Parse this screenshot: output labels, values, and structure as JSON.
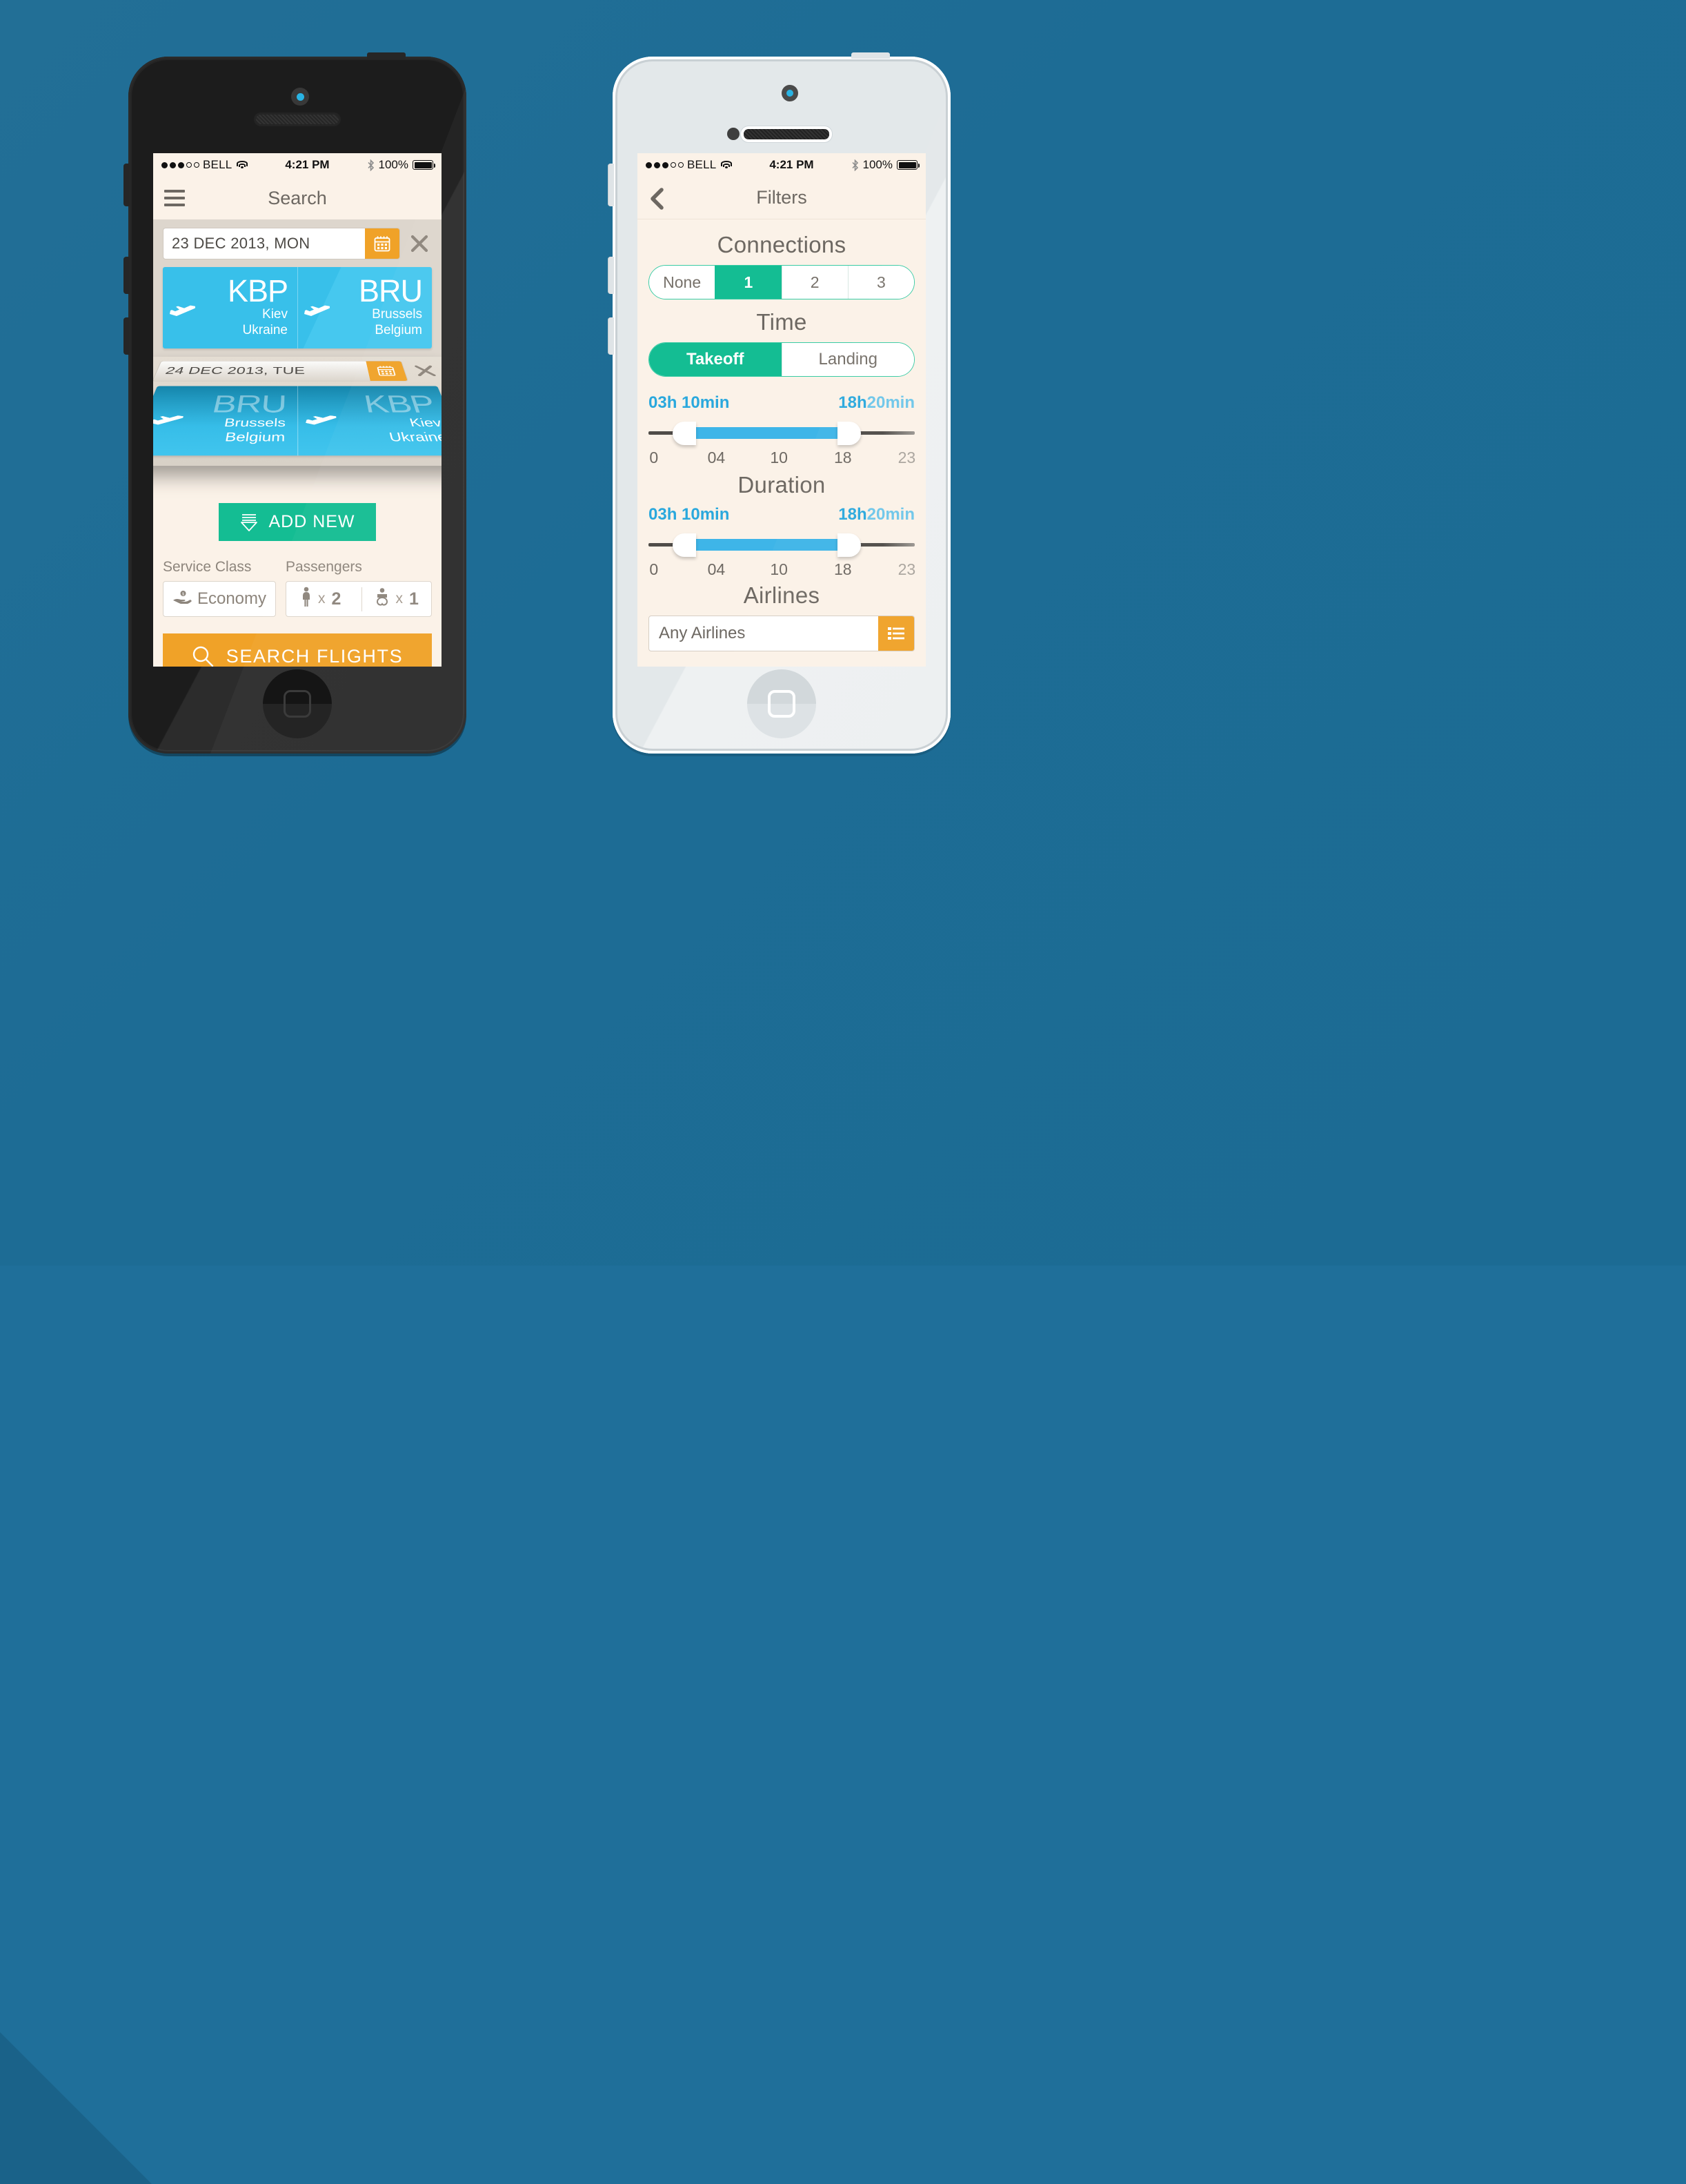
{
  "background": {
    "color": "#1f6f9a"
  },
  "theme": {
    "cream": "#fbf2e8",
    "orange": "#f0a228",
    "green": "#14bd93",
    "blue": "#38c0ea",
    "slider_blue": "#3eb5e8",
    "text_grey": "#6d6862"
  },
  "status_bar": {
    "carrier": "BELL",
    "time": "4:21 PM",
    "battery_percent": "100%",
    "signal_dots_filled": 3,
    "signal_dots_total": 5,
    "wifi_icon": "wifi-icon",
    "bluetooth_icon": "bluetooth-icon",
    "battery_icon": "battery-icon"
  },
  "left_phone": {
    "device": "black-iphone",
    "nav": {
      "menu_icon": "hamburger-icon",
      "title": "Search"
    },
    "trips": [
      {
        "date": "23 DEC 2013, MON",
        "calendar_icon": "calendar-icon",
        "remove_icon": "close-icon",
        "from": {
          "code": "KBP",
          "city": "Kiev",
          "country": "Ukraine",
          "icon": "airplane-takeoff-icon"
        },
        "to": {
          "code": "BRU",
          "city": "Brussels",
          "country": "Belgium",
          "icon": "airplane-landing-icon"
        }
      },
      {
        "date": "24 DEC 2013, TUE",
        "calendar_icon": "calendar-icon",
        "remove_icon": "close-icon",
        "from": {
          "code": "BRU",
          "city": "Brussels",
          "country": "Belgium",
          "icon": "airplane-takeoff-icon"
        },
        "to": {
          "code": "KBP",
          "city": "Kiev",
          "country": "Ukraine",
          "icon": "airplane-landing-icon"
        }
      }
    ],
    "add_new": {
      "label": "ADD NEW",
      "icon": "add-flight-icon"
    },
    "options": {
      "service_class_label": "Service Class",
      "passengers_label": "Passengers",
      "service_class_value": "Economy",
      "service_class_icon": "hand-coin-icon",
      "passengers": [
        {
          "icon": "adult-icon",
          "multiplier": "x",
          "count": "2"
        },
        {
          "icon": "infant-icon",
          "multiplier": "x",
          "count": "1"
        }
      ]
    },
    "search_button": {
      "label": "SEARCH FLIGHTS",
      "icon": "search-icon"
    }
  },
  "right_phone": {
    "device": "white-iphone",
    "nav": {
      "back_icon": "chevron-left-icon",
      "title": "Filters"
    },
    "connections": {
      "title": "Connections",
      "options": [
        "None",
        "1",
        "2",
        "3"
      ],
      "selected_index": 1
    },
    "time": {
      "title": "Time",
      "options": [
        "Takeoff",
        "Landing"
      ],
      "selected_index": 0,
      "range_low_label": "03h 10min",
      "range_high_label_bold": "18h",
      "range_high_label_dim": "20min",
      "range_high_label": "18h 20min",
      "ticks": [
        "0",
        "04",
        "10",
        "18",
        "23"
      ],
      "handle_low_percent": 18,
      "handle_high_percent": 71
    },
    "duration": {
      "title": "Duration",
      "range_low_label": "03h 10min",
      "range_high_label_bold": "18h",
      "range_high_label_dim": "20min",
      "range_high_label": "18h 20min",
      "ticks": [
        "0",
        "04",
        "10",
        "18",
        "23"
      ],
      "handle_low_percent": 18,
      "handle_high_percent": 71
    },
    "airlines": {
      "title": "Airlines",
      "value": "Any Airlines",
      "list_icon": "list-icon"
    }
  }
}
